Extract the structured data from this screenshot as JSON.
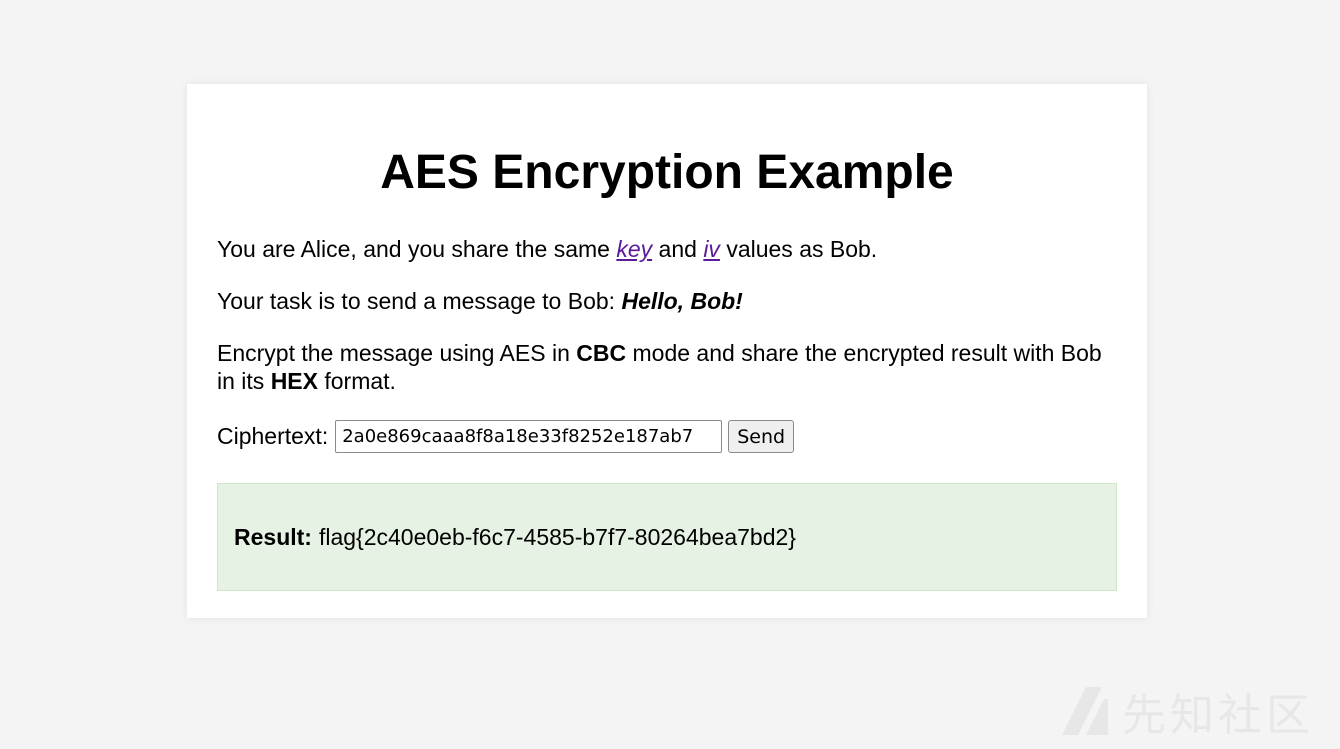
{
  "page": {
    "title": "AES Encryption Example",
    "line1": {
      "pre": "You are Alice, and you share the same ",
      "link_key": "key",
      "mid": " and ",
      "link_iv": "iv",
      "post": " values as Bob."
    },
    "line2": {
      "pre": "Your task is to send a message to Bob: ",
      "message": "Hello, Bob!"
    },
    "line3": {
      "pre": "Encrypt the message using AES in ",
      "mode": "CBC",
      "mid": " mode and share the encrypted result with Bob in its ",
      "format": "HEX",
      "post": " format."
    }
  },
  "form": {
    "label": "Ciphertext:",
    "ciphertext_value": "2a0e869caaa8f8a18e33f8252e187ab7",
    "send_label": "Send"
  },
  "result": {
    "label": "Result:",
    "value": "flag{2c40e0eb-f6c7-4585-b7f7-80264bea7bd2}"
  },
  "watermark": {
    "text": "先知社区",
    "icon": "xianzhi-logo-icon"
  },
  "colors": {
    "link": "#5b1a9a",
    "result_bg": "#e6f2e3",
    "page_bg": "#f4f4f4"
  }
}
